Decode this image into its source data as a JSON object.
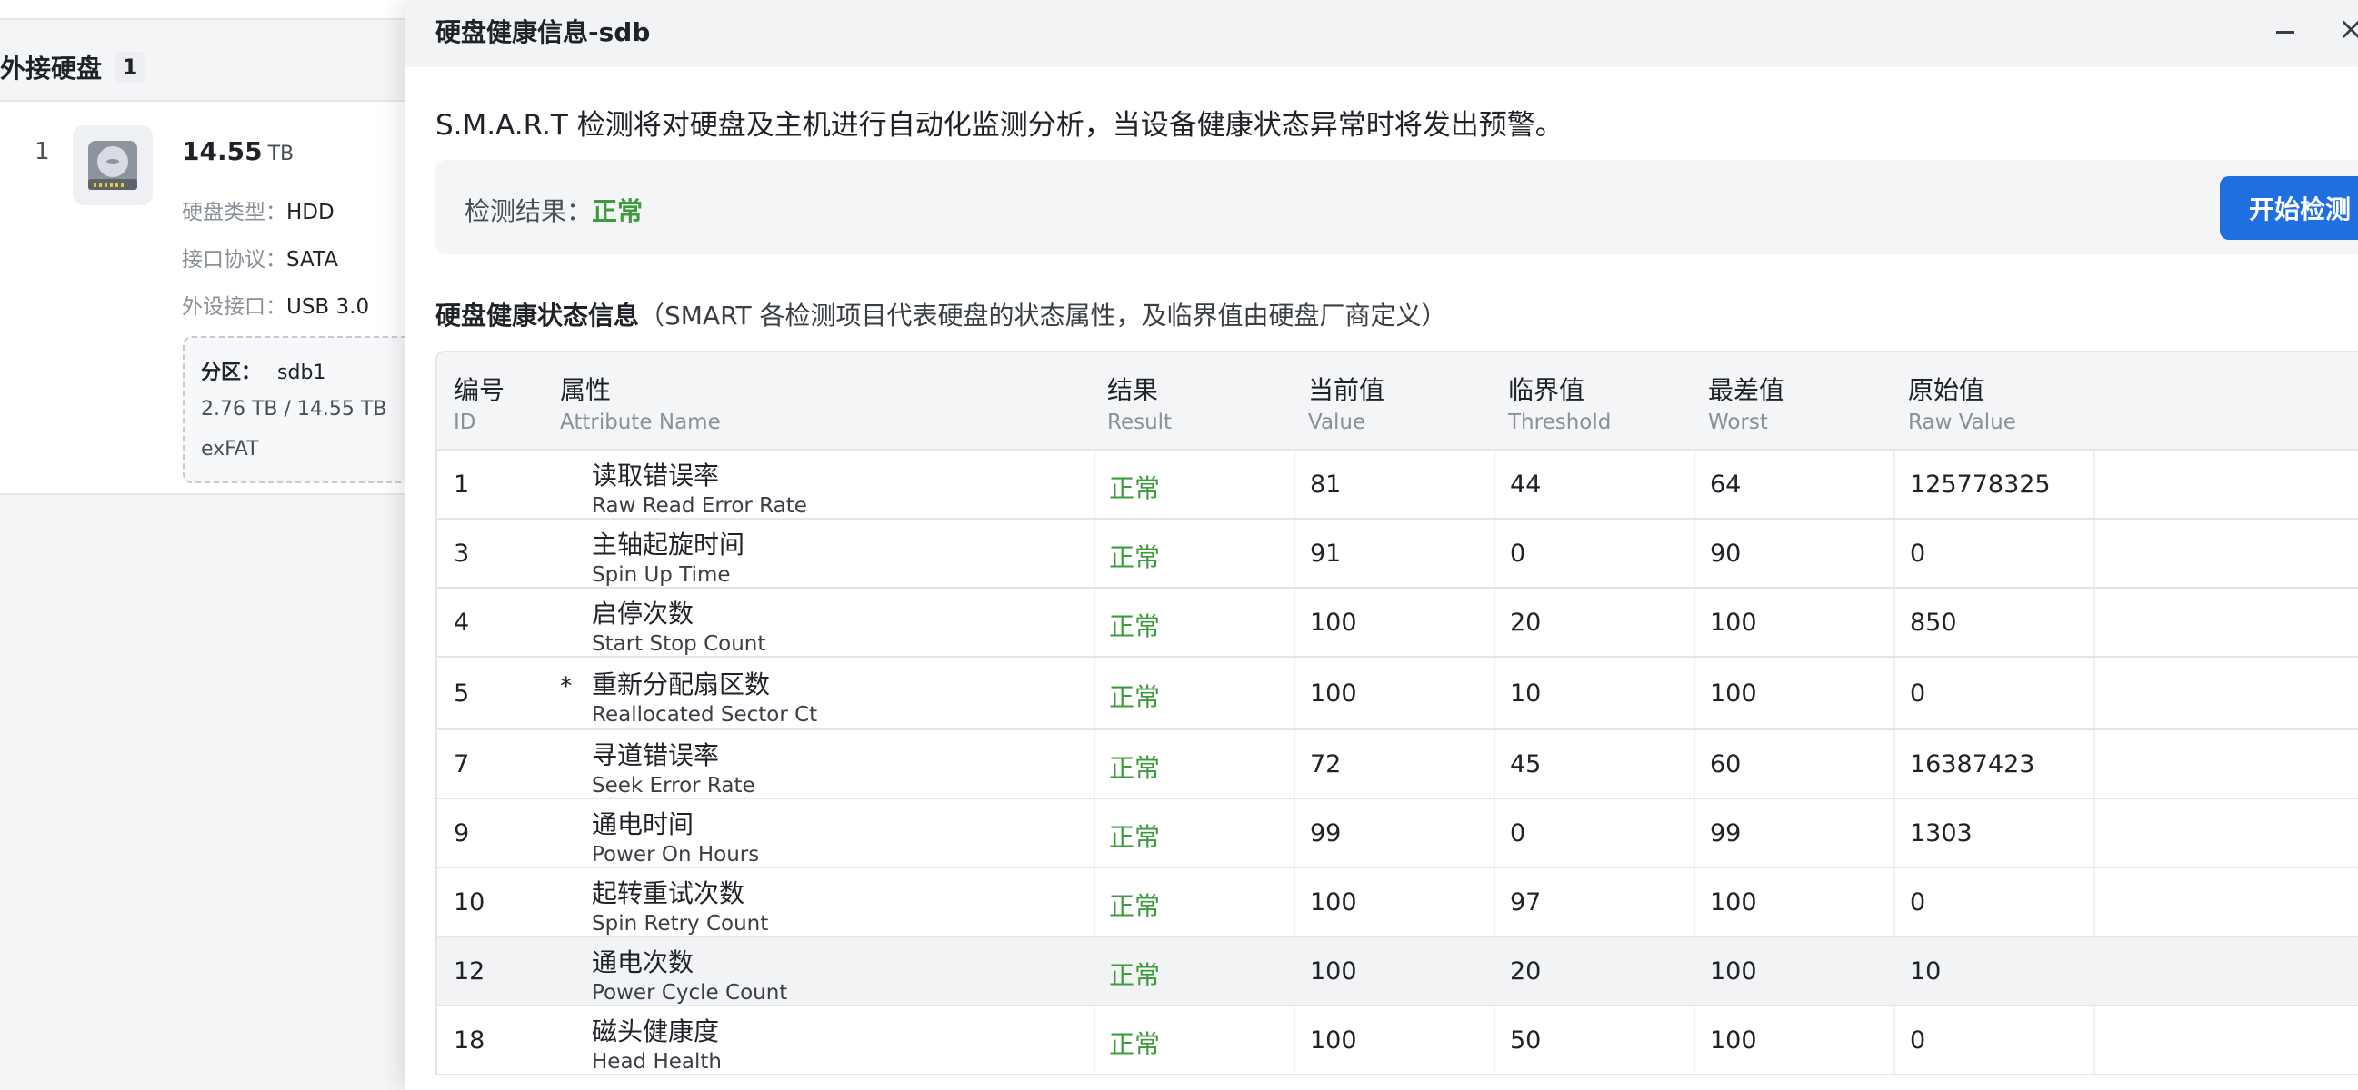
{
  "left_panel": {
    "section_title": "外接硬盘",
    "section_count": "1",
    "disk": {
      "index": "1",
      "size_value": "14.55",
      "size_unit": "TB",
      "type_key": "硬盘类型：",
      "type_value": "HDD",
      "protocol_key": "接口协议：",
      "protocol_value": "SATA",
      "port_key": "外设接口：",
      "port_value": "USB 3.0",
      "partition": {
        "label": "分区：",
        "name": "sdb1",
        "usage": "2.76 TB / 14.55 TB",
        "fs": "exFAT"
      }
    }
  },
  "dialog": {
    "title": "硬盘健康信息-sdb",
    "intro": "S.M.A.R.T 检测将对硬盘及主机进行自动化监测分析，当设备健康状态异常时将发出预警。",
    "result_label": "检测结果：",
    "result_value": "正常",
    "start_button": "开始检测",
    "table_title": "硬盘健康状态信息",
    "table_note": "（SMART 各检测项目代表硬盘的状态属性，及临界值由硬盘厂商定义）",
    "columns": {
      "id": {
        "zh": "编号",
        "en": "ID"
      },
      "attr": {
        "zh": "属性",
        "en": "Attribute Name"
      },
      "result": {
        "zh": "结果",
        "en": "Result"
      },
      "value": {
        "zh": "当前值",
        "en": "Value"
      },
      "threshold": {
        "zh": "临界值",
        "en": "Threshold"
      },
      "worst": {
        "zh": "最差值",
        "en": "Worst"
      },
      "raw": {
        "zh": "原始值",
        "en": "Raw Value"
      }
    },
    "rows": [
      {
        "id": "1",
        "star": "",
        "zh": "读取错误率",
        "en": "Raw Read Error Rate",
        "result": "正常",
        "value": "81",
        "threshold": "44",
        "worst": "64",
        "raw": "125778325"
      },
      {
        "id": "3",
        "star": "",
        "zh": "主轴起旋时间",
        "en": "Spin Up Time",
        "result": "正常",
        "value": "91",
        "threshold": "0",
        "worst": "90",
        "raw": "0"
      },
      {
        "id": "4",
        "star": "",
        "zh": "启停次数",
        "en": "Start Stop Count",
        "result": "正常",
        "value": "100",
        "threshold": "20",
        "worst": "100",
        "raw": "850"
      },
      {
        "id": "5",
        "star": "*",
        "zh": "重新分配扇区数",
        "en": "Reallocated Sector Ct",
        "result": "正常",
        "value": "100",
        "threshold": "10",
        "worst": "100",
        "raw": "0"
      },
      {
        "id": "7",
        "star": "",
        "zh": "寻道错误率",
        "en": "Seek Error Rate",
        "result": "正常",
        "value": "72",
        "threshold": "45",
        "worst": "60",
        "raw": "16387423"
      },
      {
        "id": "9",
        "star": "",
        "zh": "通电时间",
        "en": "Power On Hours",
        "result": "正常",
        "value": "99",
        "threshold": "0",
        "worst": "99",
        "raw": "1303"
      },
      {
        "id": "10",
        "star": "",
        "zh": "起转重试次数",
        "en": "Spin Retry Count",
        "result": "正常",
        "value": "100",
        "threshold": "97",
        "worst": "100",
        "raw": "0"
      },
      {
        "id": "12",
        "star": "",
        "zh": "通电次数",
        "en": "Power Cycle Count",
        "result": "正常",
        "value": "100",
        "threshold": "20",
        "worst": "100",
        "raw": "10"
      },
      {
        "id": "18",
        "star": "",
        "zh": "磁头健康度",
        "en": "Head Health",
        "result": "正常",
        "value": "100",
        "threshold": "50",
        "worst": "100",
        "raw": "0"
      }
    ]
  },
  "icons": {
    "disk": "hard-disk-icon",
    "minimize": "minimize-icon",
    "close": "close-icon"
  },
  "colors": {
    "accent": "#1f6fe0",
    "ok": "#3d9b3d"
  }
}
